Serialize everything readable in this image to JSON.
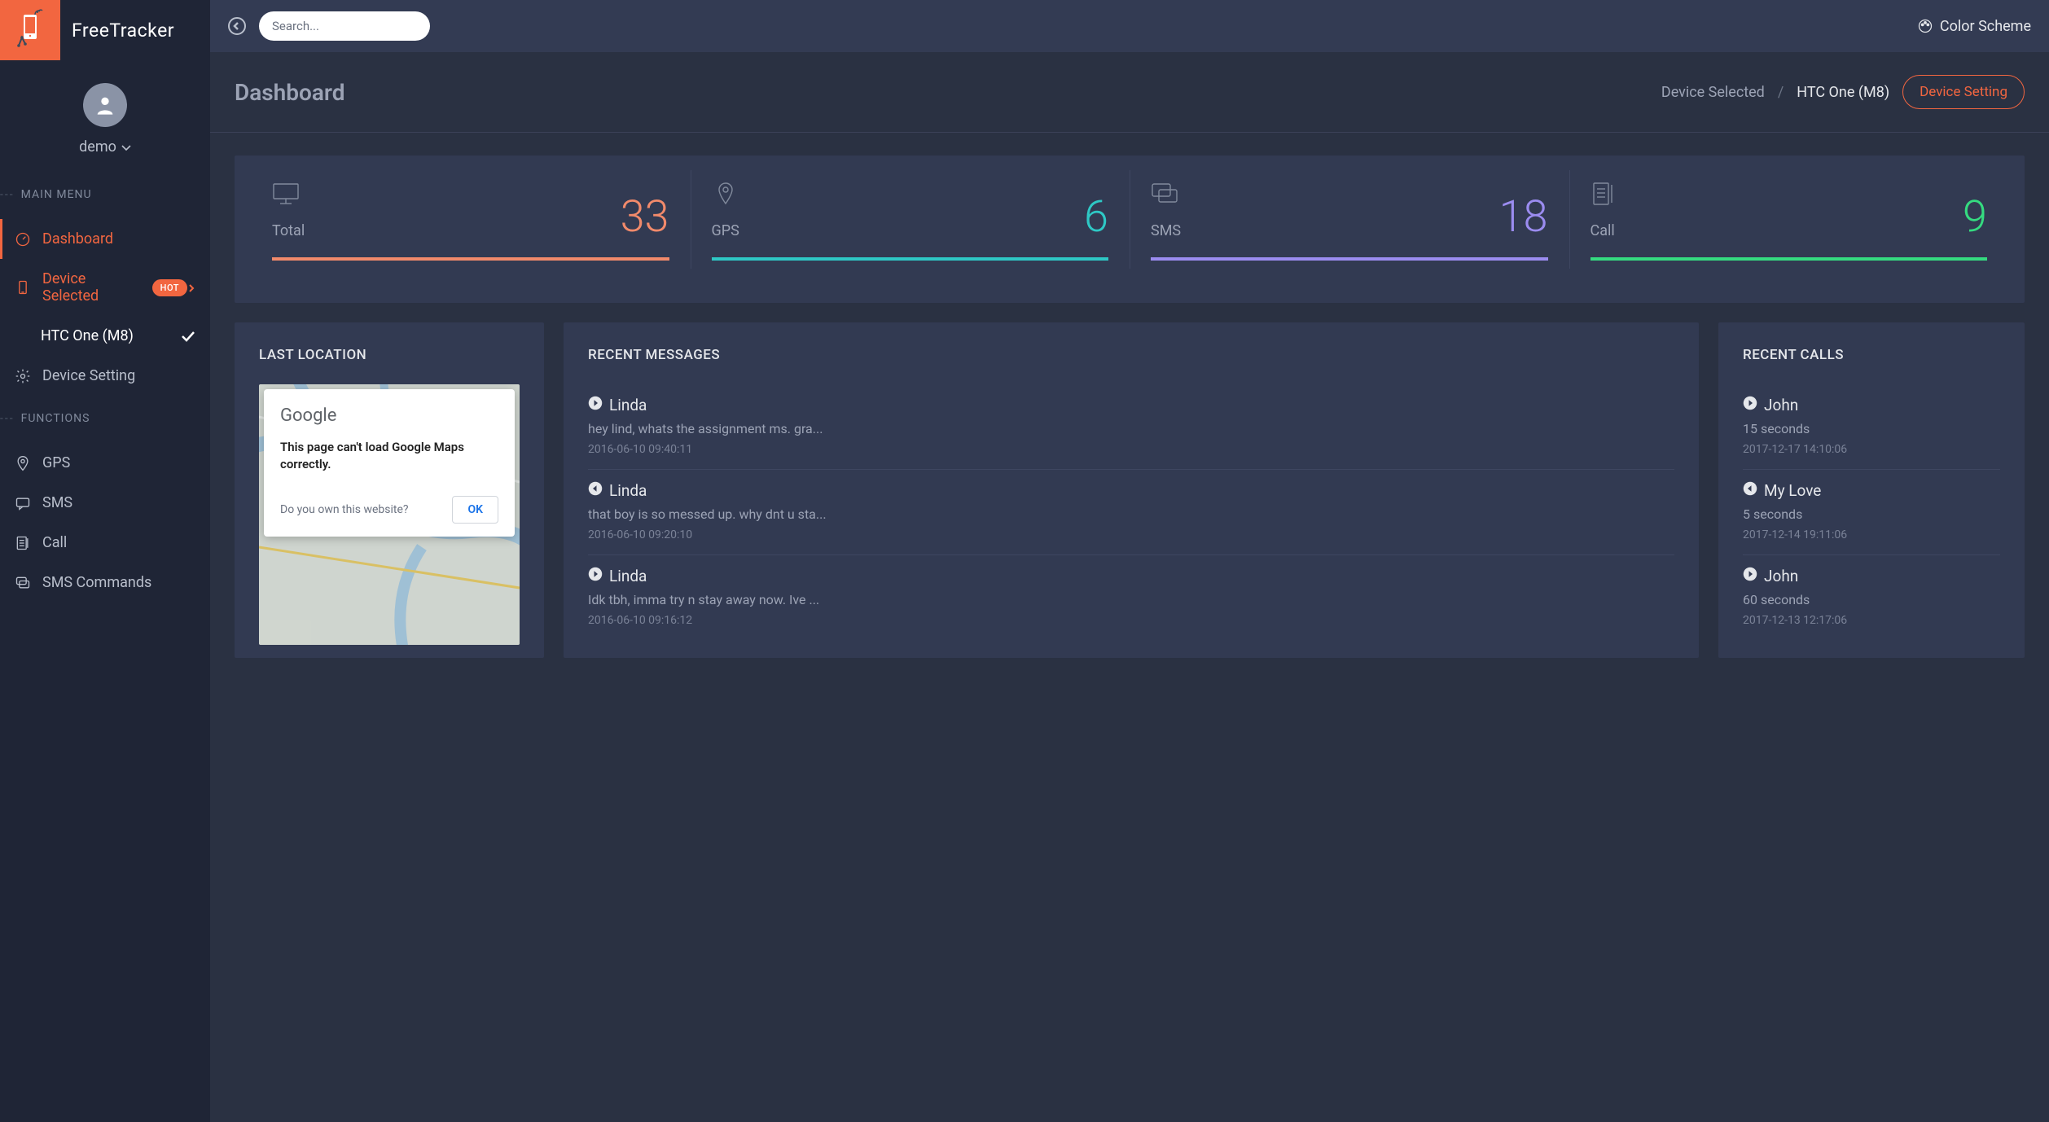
{
  "brand": {
    "name": "FreeTracker"
  },
  "user": {
    "name": "demo"
  },
  "topbar": {
    "search_placeholder": "Search...",
    "color_scheme": "Color Scheme"
  },
  "sidebar": {
    "sections": {
      "main": {
        "title": "MAIN MENU",
        "items": [
          {
            "label": "Dashboard"
          },
          {
            "label": "Device Selected",
            "badge": "HOT",
            "sub": [
              {
                "label": "HTC One (M8)"
              }
            ]
          },
          {
            "label": "Device Setting"
          }
        ]
      },
      "functions": {
        "title": "FUNCTIONS",
        "items": [
          {
            "label": "GPS"
          },
          {
            "label": "SMS"
          },
          {
            "label": "Call"
          },
          {
            "label": "SMS Commands"
          }
        ]
      }
    }
  },
  "header": {
    "title": "Dashboard",
    "device_selected_label": "Device Selected",
    "device_selected_value": "HTC One (M8)",
    "device_setting_label": "Device Setting"
  },
  "stats": [
    {
      "label": "Total",
      "value": "33"
    },
    {
      "label": "GPS",
      "value": "6"
    },
    {
      "label": "SMS",
      "value": "18"
    },
    {
      "label": "Call",
      "value": "9"
    }
  ],
  "panels": {
    "location": {
      "title": "LAST LOCATION",
      "google_logo": "Google",
      "error_message": "This page can't load Google Maps correctly.",
      "question": "Do you own this website?",
      "ok": "OK"
    },
    "messages": {
      "title": "RECENT MESSAGES",
      "items": [
        {
          "name": "Linda",
          "dir": "out",
          "body": "hey lind, whats the assignment ms. gra...",
          "time": "2016-06-10 09:40:11"
        },
        {
          "name": "Linda",
          "dir": "in",
          "body": "that boy is so messed up. why dnt u sta...",
          "time": "2016-06-10 09:20:10"
        },
        {
          "name": "Linda",
          "dir": "out",
          "body": "Idk tbh, imma try n stay away now. Ive ...",
          "time": "2016-06-10 09:16:12"
        }
      ]
    },
    "calls": {
      "title": "RECENT CALLS",
      "items": [
        {
          "name": "John",
          "dir": "out",
          "body": "15 seconds",
          "time": "2017-12-17 14:10:06"
        },
        {
          "name": "My Love",
          "dir": "in",
          "body": "5 seconds",
          "time": "2017-12-14 19:11:06"
        },
        {
          "name": "John",
          "dir": "out",
          "body": "60 seconds",
          "time": "2017-12-13 12:17:06"
        }
      ]
    }
  }
}
